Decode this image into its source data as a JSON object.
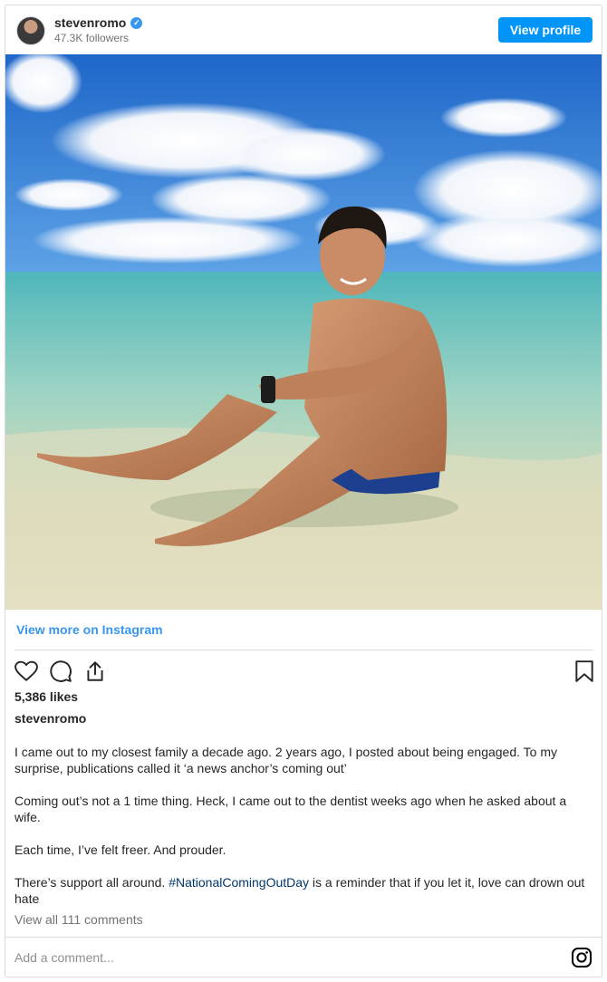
{
  "header": {
    "username": "stevenromo",
    "verified_mark": "✓",
    "followers": "47.3K followers",
    "view_profile_label": "View profile"
  },
  "photo": {
    "alt": "Man sitting in shallow turquoise water on a beach under a blue sky with clouds"
  },
  "view_more_label": "View more on Instagram",
  "actions": {
    "icons": [
      "heart-icon",
      "comment-icon",
      "share-icon",
      "bookmark-icon"
    ]
  },
  "likes": "5,386 likes",
  "caption": {
    "username": "stevenromo",
    "paragraphs": [
      "I came out to my closest family a decade ago. 2 years ago, I posted about being engaged. To my surprise, publications called it ‘a news anchor’s coming out’",
      "Coming out’s not a 1 time thing. Heck, I came out to the dentist weeks ago when he asked about a wife.",
      "Each time, I’ve felt freer. And prouder."
    ],
    "last_paragraph": {
      "before": "There’s support all around. ",
      "hashtag": "#NationalComingOutDay",
      "after": " is a reminder that if you let it, love can drown out hate"
    }
  },
  "view_comments_label": "View all 111 comments",
  "comment": {
    "placeholder": "Add a comment..."
  },
  "colors": {
    "accent": "#0095f6",
    "link": "#3897f0",
    "hashtag": "#00376b"
  }
}
